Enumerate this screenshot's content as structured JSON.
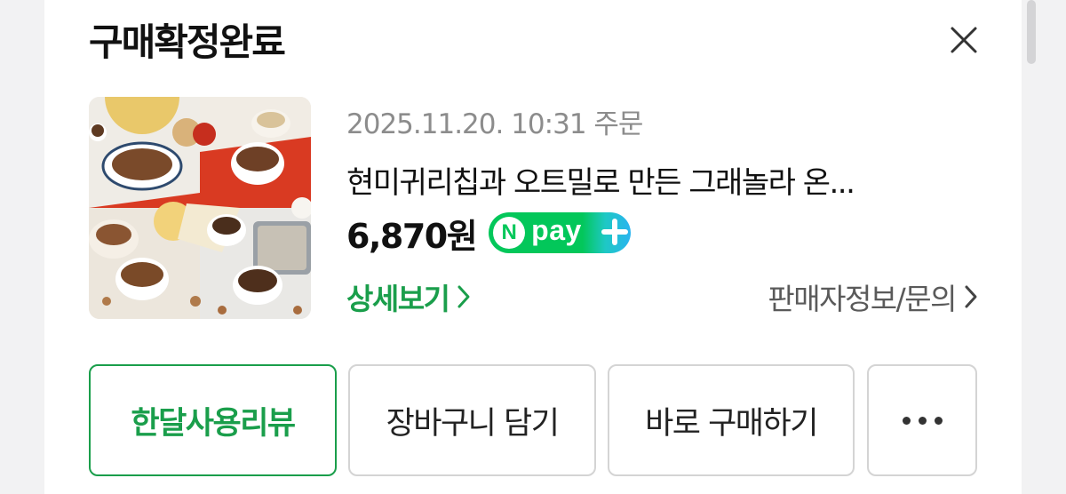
{
  "modal": {
    "title": "구매확정완료"
  },
  "order": {
    "date_text": "2025.11.20. 10:31 주문",
    "product_name": "현미귀리칩과 오트밀로 만든 그래놀라 온...",
    "price": "6,870원",
    "pay_badge": {
      "n_letter": "N",
      "text": "pay",
      "icon": "plus-icon"
    }
  },
  "links": {
    "detail": "상세보기",
    "seller": "판매자정보/문의"
  },
  "actions": {
    "review": "한달사용리뷰",
    "cart": "장바구니 담기",
    "buy": "바로 구매하기",
    "more_icon": "more-dots-icon"
  },
  "colors": {
    "accent_green": "#1a9e4b",
    "npay_green": "#03c75a",
    "npay_blue": "#2ab4f0"
  }
}
